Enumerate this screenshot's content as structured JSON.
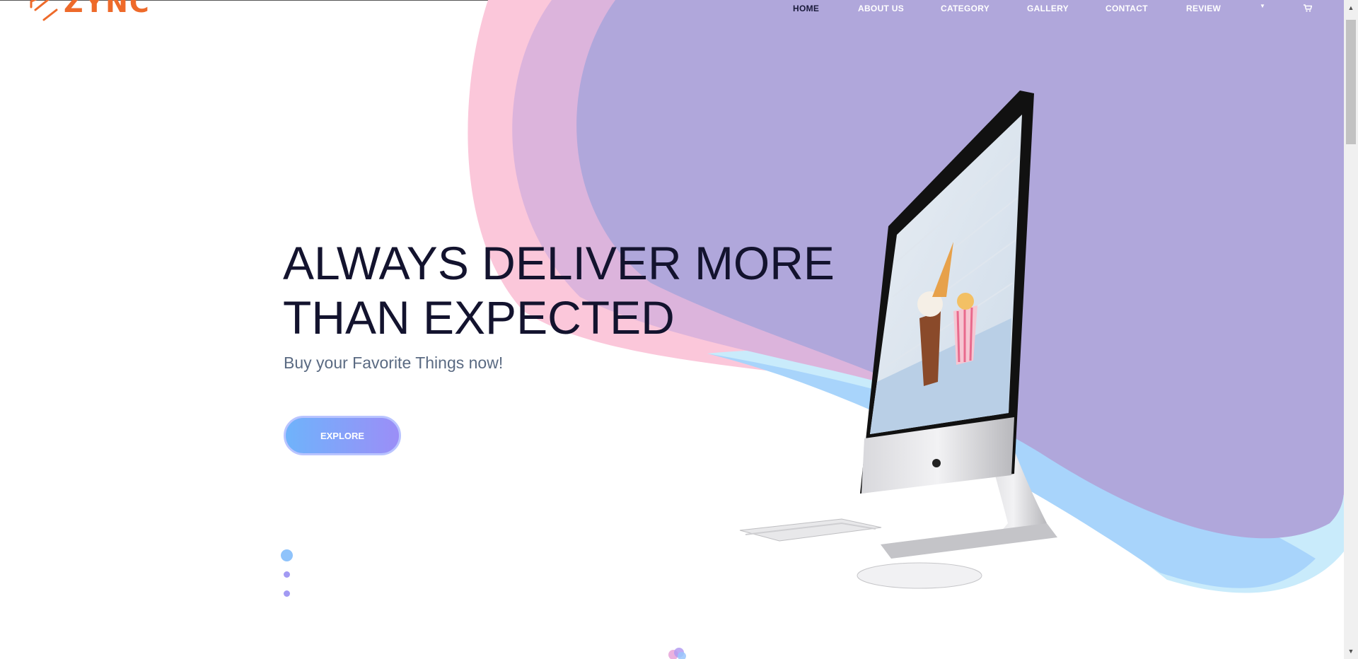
{
  "logo": {
    "text": "ZYNC"
  },
  "nav": {
    "items": [
      {
        "label": "HOME",
        "active": true
      },
      {
        "label": "ABOUT US",
        "active": false
      },
      {
        "label": "CATEGORY",
        "active": false
      },
      {
        "label": "GALLERY",
        "active": false
      },
      {
        "label": "CONTACT",
        "active": false
      },
      {
        "label": "REVIEW",
        "active": false
      }
    ],
    "dropdown_icon": "caret-down-icon",
    "cart_icon": "shopping-cart-icon"
  },
  "hero": {
    "title_line1": "ALWAYS DELIVER MORE",
    "title_line2": "THAN EXPECTED",
    "subtitle": "Buy your Favorite Things now!",
    "button_label": "EXPLORE"
  },
  "slider": {
    "slide_count": 3,
    "active_index": 0
  },
  "colors": {
    "brand": "#ee6a2a",
    "heading": "#13132e",
    "subtitle": "#5a6a82",
    "pink_blob": "#fbc7da",
    "purple_blob": "#b0a7db",
    "blue_blob": "#a8d4fb",
    "button_gradient_start": "#6fb3fb",
    "button_gradient_end": "#9b8ef7"
  }
}
